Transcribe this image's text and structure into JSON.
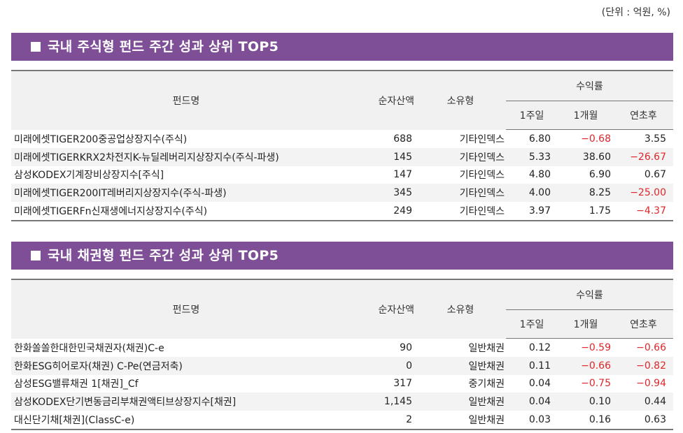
{
  "unit_note": "(단위 : 억원, %)",
  "headers": {
    "fund_name": "펀드명",
    "net_assets": "순자산액",
    "category": "소유형",
    "returns": "수익률",
    "week1": "1주일",
    "month1": "1개월",
    "ytd": "연초후"
  },
  "equity": {
    "title": "국내 주식형 펀드 주간 성과 상위 TOP5",
    "rows": [
      {
        "name": "미래에셋TIGER200중공업상장지수(주식)",
        "assets": "688",
        "type": "기타인덱스",
        "w1": "6.80",
        "m1": "-0.68",
        "ytd": "3.55"
      },
      {
        "name": "미래에셋TIGERKRX2차전지K-뉴딜레버리지상장지수(주식-파생)",
        "assets": "145",
        "type": "기타인덱스",
        "w1": "5.33",
        "m1": "38.60",
        "ytd": "-26.67"
      },
      {
        "name": "삼성KODEX기계장비상장지수[주식]",
        "assets": "147",
        "type": "기타인덱스",
        "w1": "4.80",
        "m1": "6.90",
        "ytd": "0.67"
      },
      {
        "name": "미래에셋TIGER200IT레버리지상장지수(주식-파생)",
        "assets": "345",
        "type": "기타인덱스",
        "w1": "4.00",
        "m1": "8.25",
        "ytd": "-25.00"
      },
      {
        "name": "미래에셋TIGERFn신재생에너지상장지수(주식)",
        "assets": "249",
        "type": "기타인덱스",
        "w1": "3.97",
        "m1": "1.75",
        "ytd": "-4.37"
      }
    ]
  },
  "bond": {
    "title": "국내 채권형 펀드 주간 성과 상위 TOP5",
    "rows": [
      {
        "name": "한화쏠쏠한대한민국채권자(채권)C-e",
        "assets": "90",
        "type": "일반채권",
        "w1": "0.12",
        "m1": "-0.59",
        "ytd": "-0.66"
      },
      {
        "name": "한화ESG히어로자(채권) C-Pe(연금저축)",
        "assets": "0",
        "type": "일반채권",
        "w1": "0.11",
        "m1": "-0.66",
        "ytd": "-0.82"
      },
      {
        "name": "삼성ESG밸류채권 1[채권]_Cf",
        "assets": "317",
        "type": "중기채권",
        "w1": "0.04",
        "m1": "-0.75",
        "ytd": "-0.94"
      },
      {
        "name": "삼성KODEX단기변동금리부채권액티브상장지수[채권]",
        "assets": "1,145",
        "type": "일반채권",
        "w1": "0.04",
        "m1": "0.10",
        "ytd": "0.44"
      },
      {
        "name": "대신단기채[채권](ClassC-e)",
        "assets": "2",
        "type": "일반채권",
        "w1": "0.03",
        "m1": "0.16",
        "ytd": "0.63"
      }
    ]
  },
  "colors": {
    "banner": "#7e4f96",
    "negative": "#e0262b"
  }
}
